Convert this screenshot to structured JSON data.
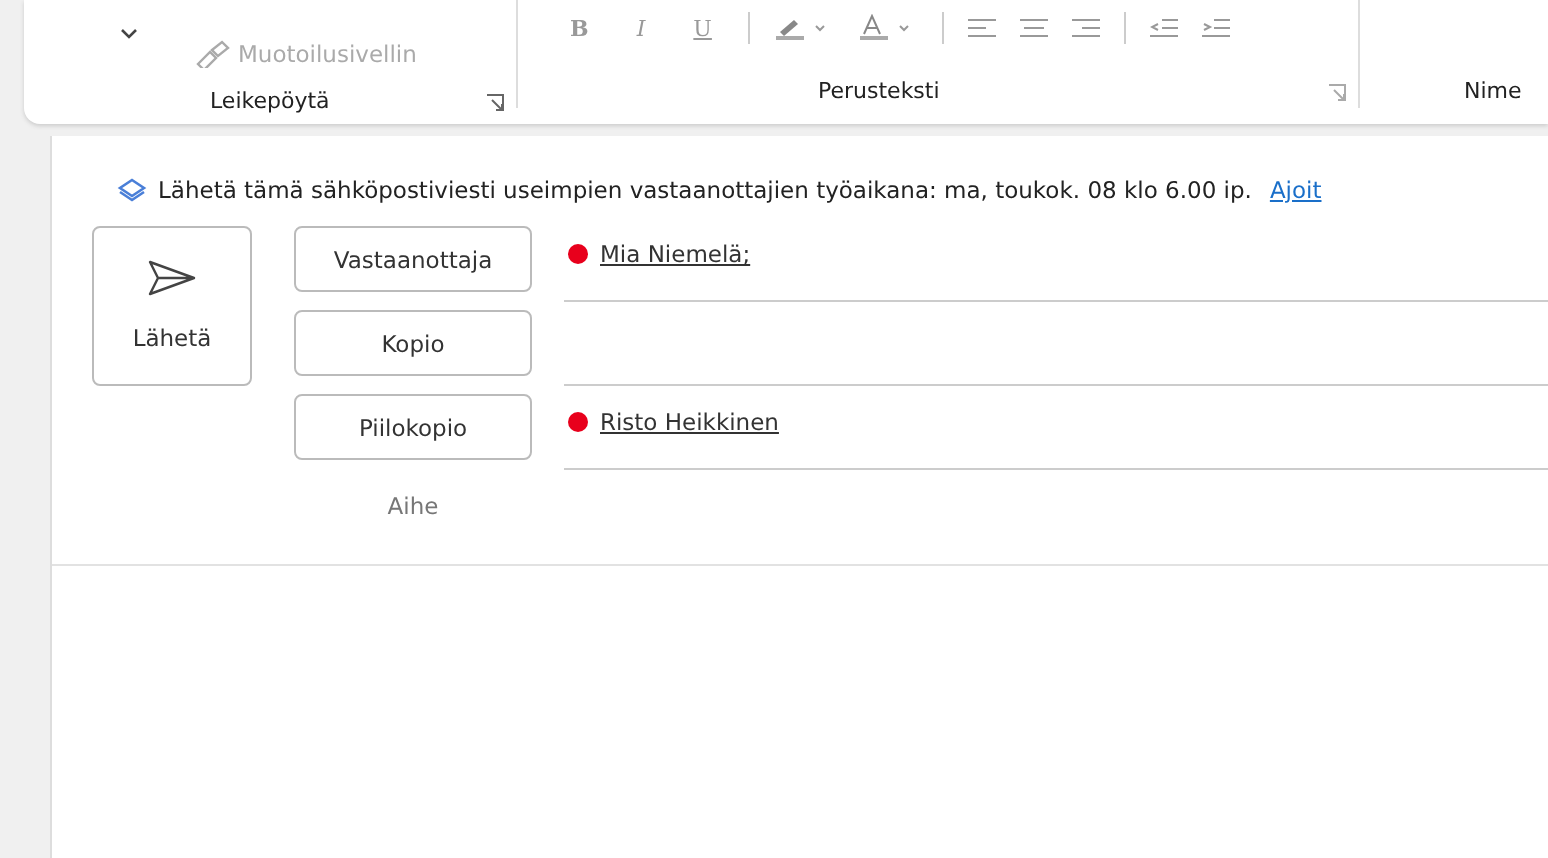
{
  "ribbon": {
    "clipboard": {
      "label": "Leikepöytä",
      "format_painter": {
        "label": "Muotoilusivellin",
        "disabled": true
      }
    },
    "basic_text": {
      "label": "Perusteksti",
      "format_buttons": [
        {
          "label": "B",
          "disabled": true
        },
        {
          "label": "I",
          "disabled": true
        },
        {
          "label": "U",
          "disabled": true
        }
      ]
    },
    "next_group": {
      "label": "Nime"
    }
  },
  "compose": {
    "info": {
      "text": "Lähetä tämä sähköpostiviesti useimpien vastaanottajien työaikana: ma, toukok. 08 klo 6.00 ip.",
      "link": "Ajoit"
    },
    "send_button": "Lähetä",
    "fields": [
      {
        "button": "Vastaanottaja",
        "recipients": [
          {
            "name": "Mia Niemelä;",
            "color": "#e8001c"
          }
        ]
      },
      {
        "button": "Kopio"
      },
      {
        "button": "Piilokopio",
        "recipients": [
          {
            "name": "Risto Heikkinen",
            "color": "#e8001c"
          }
        ]
      }
    ],
    "subject_label": "Aihe"
  }
}
